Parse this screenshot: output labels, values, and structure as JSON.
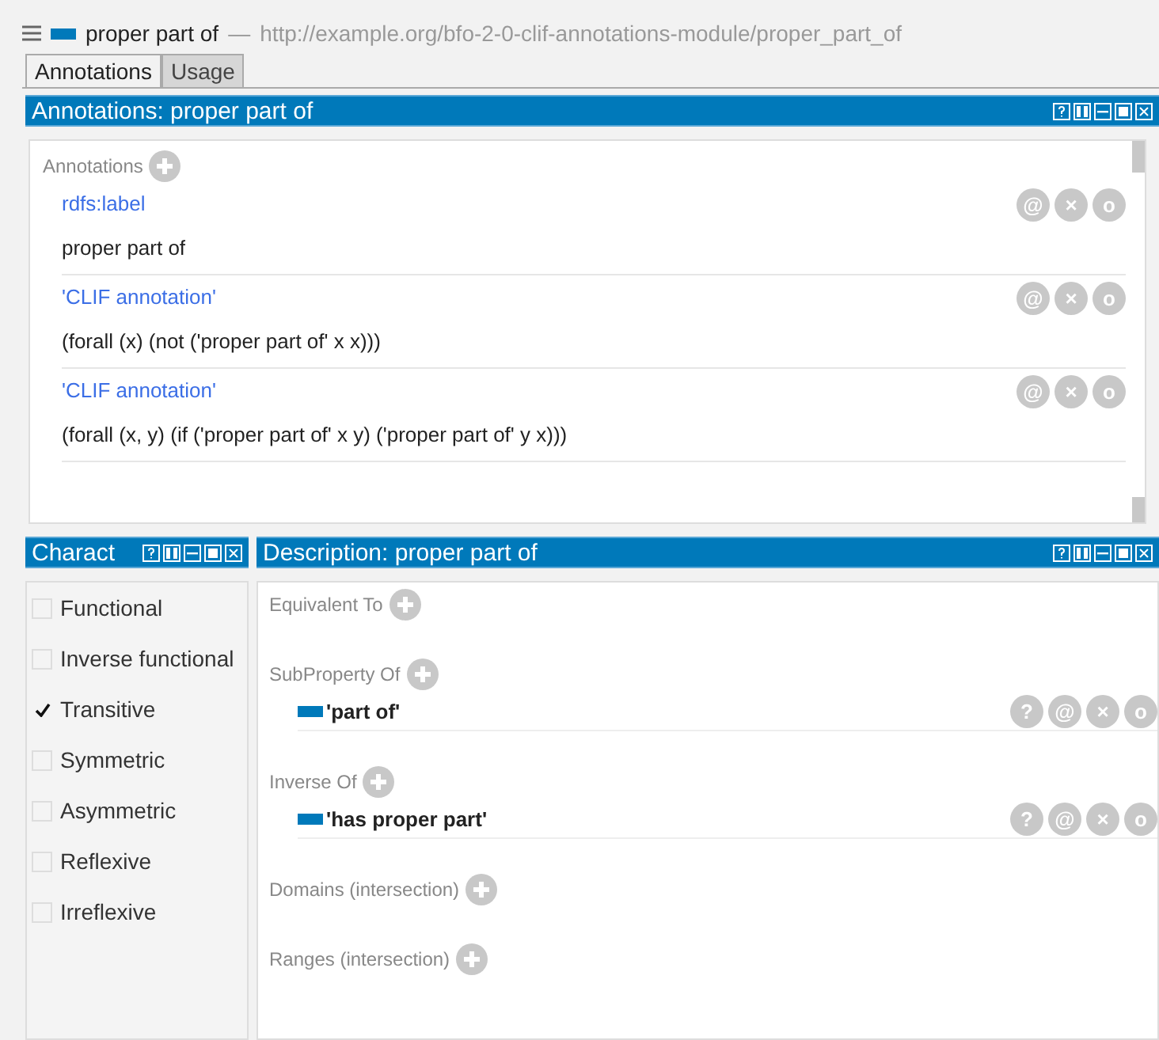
{
  "header": {
    "title": "proper part of",
    "separator": "—",
    "iri": "http://example.org/bfo-2-0-clif-annotations-module/proper_part_of"
  },
  "tabs": [
    {
      "label": "Annotations",
      "selected": true
    },
    {
      "label": "Usage",
      "selected": false
    }
  ],
  "annotations_panel": {
    "title": "Annotations: proper part of",
    "section_label": "Annotations",
    "items": [
      {
        "property": "rdfs:label",
        "value": "proper part of",
        "buttons": [
          "@",
          "×",
          "o"
        ]
      },
      {
        "property": "'CLIF annotation'",
        "value": "(forall (x) (not ('proper part of' x x)))",
        "buttons": [
          "@",
          "×",
          "o"
        ]
      },
      {
        "property": "'CLIF annotation'",
        "value": "(forall (x, y)  (if ('proper part of' x y) ('proper part of' y x)))",
        "buttons": [
          "@",
          "×",
          "o"
        ]
      }
    ]
  },
  "characteristics_panel": {
    "title": "Charact",
    "items": [
      {
        "label": "Functional",
        "checked": false
      },
      {
        "label": "Inverse functional",
        "checked": false
      },
      {
        "label": "Transitive",
        "checked": true
      },
      {
        "label": "Symmetric",
        "checked": false
      },
      {
        "label": "Asymmetric",
        "checked": false
      },
      {
        "label": "Reflexive",
        "checked": false
      },
      {
        "label": "Irreflexive",
        "checked": false
      }
    ]
  },
  "description_panel": {
    "title": "Description: proper part of",
    "sections": [
      {
        "label": "Equivalent To"
      },
      {
        "label": "SubProperty Of",
        "items": [
          {
            "name": "'part of'",
            "buttons": [
              "?",
              "@",
              "×",
              "o"
            ]
          }
        ]
      },
      {
        "label": "Inverse Of",
        "items": [
          {
            "name": "'has proper part'",
            "buttons": [
              "?",
              "@",
              "×",
              "o"
            ]
          }
        ]
      },
      {
        "label": "Domains (intersection)"
      },
      {
        "label": "Ranges (intersection)"
      }
    ]
  }
}
